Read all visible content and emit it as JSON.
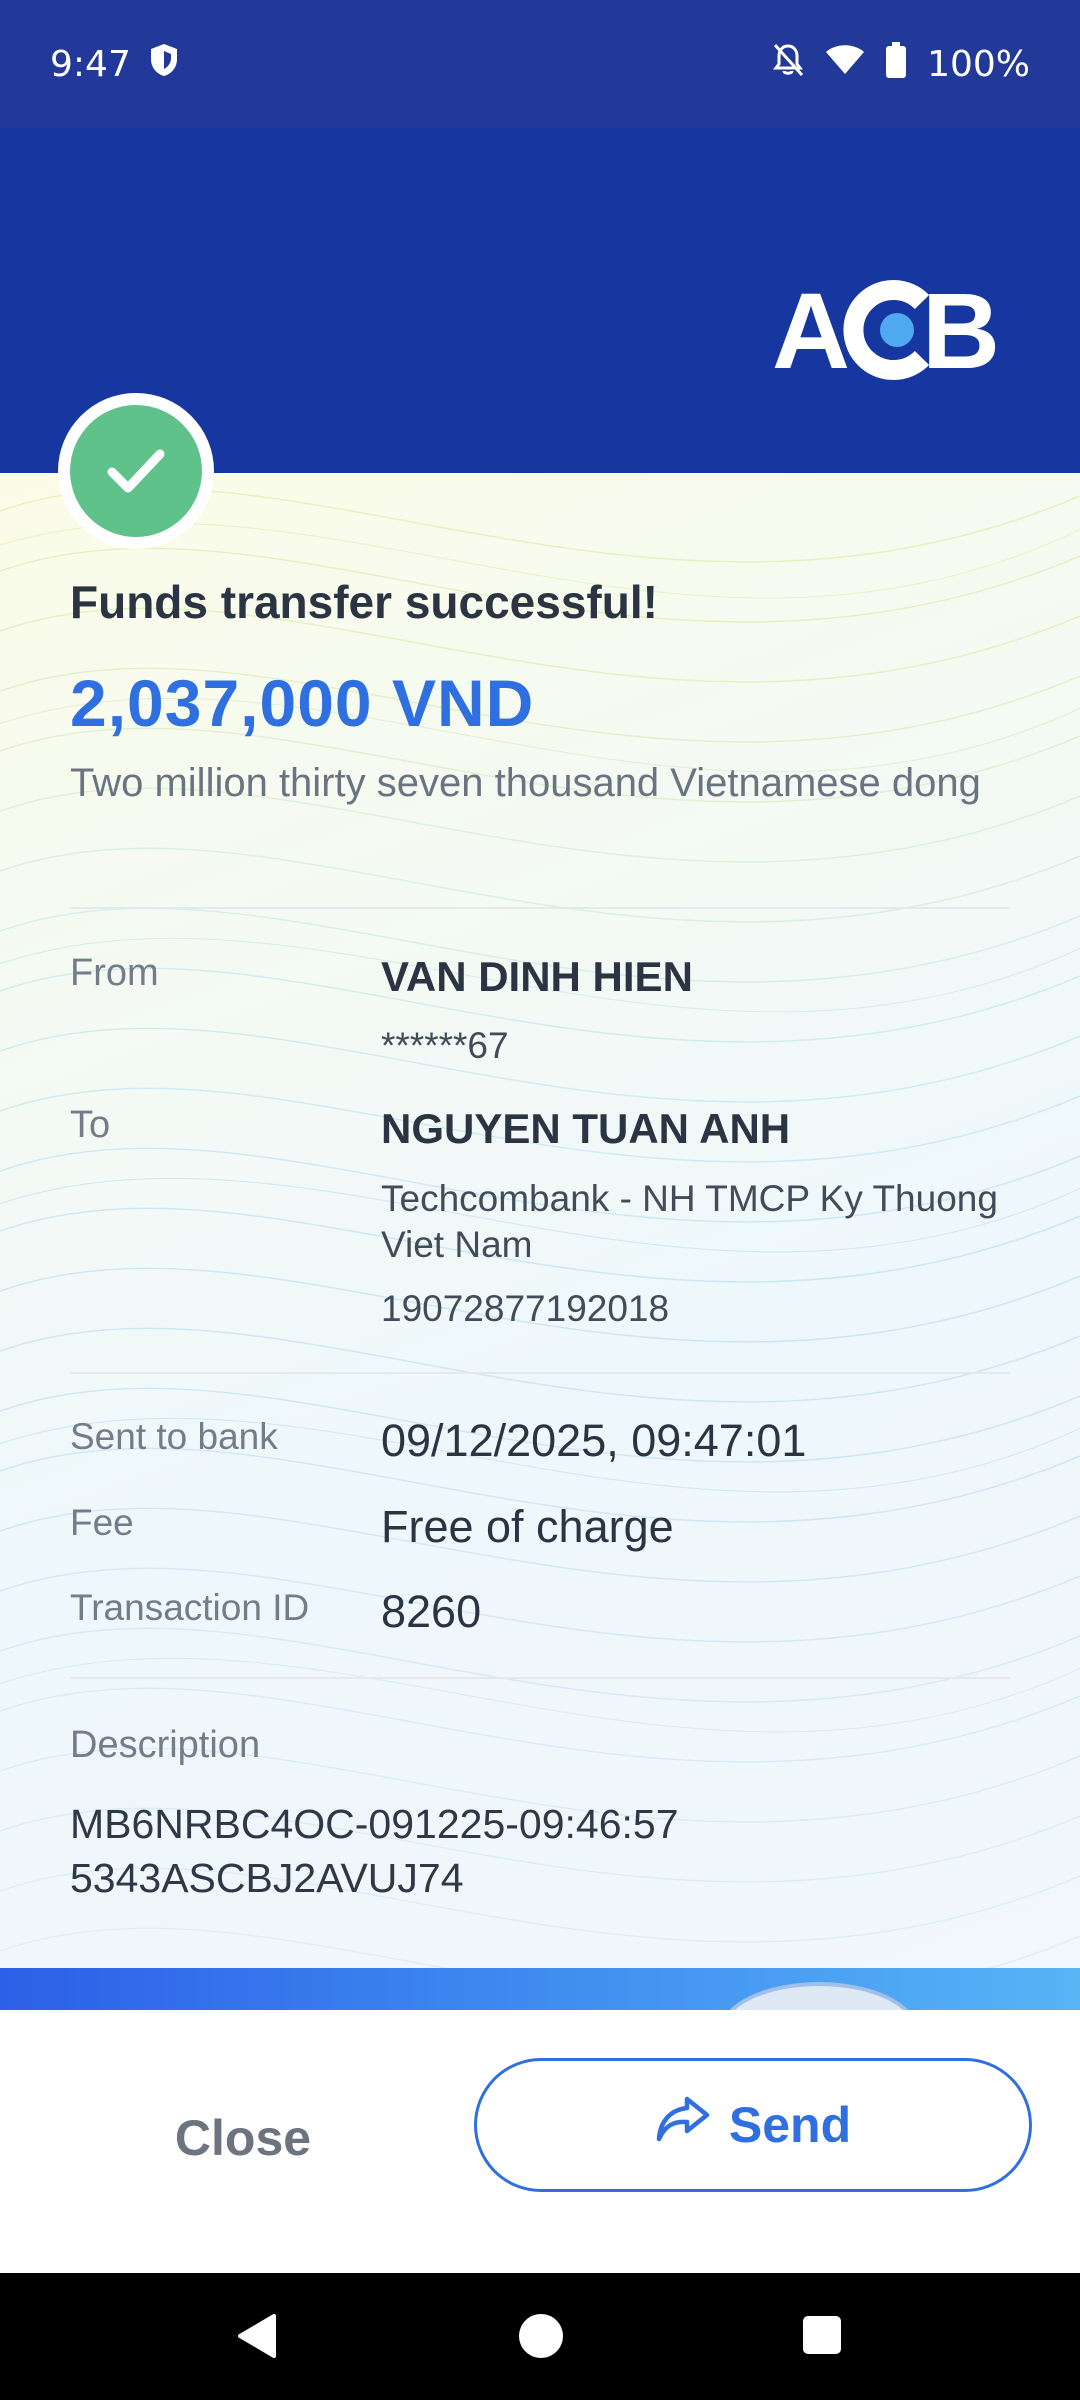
{
  "status_bar": {
    "time": "9:47",
    "battery": "100%",
    "icons": [
      "shield-icon",
      "bell-off-icon",
      "wifi-icon",
      "battery-icon"
    ]
  },
  "header": {
    "logo_text": "ACB",
    "color": "#1737a0"
  },
  "receipt": {
    "title": "Funds transfer successful!",
    "amount": "2,037,000 VND",
    "amount_words": "Two million thirty seven thousand Vietnamese dong",
    "from": {
      "label": "From",
      "name": "VAN DINH HIEN",
      "account": "******67"
    },
    "to": {
      "label": "To",
      "name": "NGUYEN TUAN ANH",
      "bank": "Techcombank - NH TMCP Ky Thuong Viet Nam",
      "account": "19072877192018"
    },
    "sent_to_bank": {
      "label": "Sent to bank",
      "value": "09/12/2025, 09:47:01"
    },
    "fee": {
      "label": "Fee",
      "value": "Free of charge"
    },
    "transaction_id": {
      "label": "Transaction ID",
      "value": "8260"
    },
    "description": {
      "label": "Description",
      "value": "MB6NRBC4OC-091225-09:46:57 5343ASCBJ2AVUJ74"
    }
  },
  "actions": {
    "close_label": "Close",
    "send_label": "Send"
  },
  "colors": {
    "accent": "#2f6fe0",
    "success": "#5fc28a",
    "brand": "#1737a0"
  }
}
